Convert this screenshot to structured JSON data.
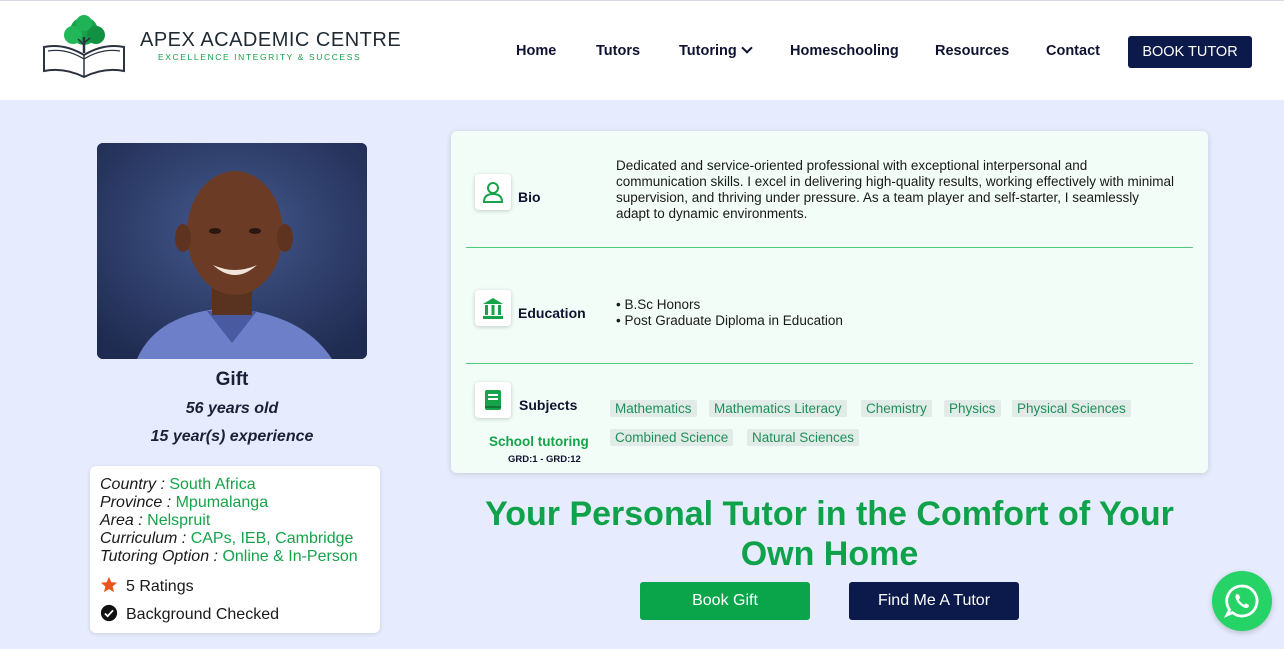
{
  "brand": {
    "title": "APEX ACADEMIC CENTRE",
    "tagline": "EXCELLENCE INTEGRITY & SUCCESS",
    "green": "#16a34a",
    "navy": "#0c1a4b"
  },
  "nav": {
    "items": [
      "Home",
      "Tutors",
      "Tutoring",
      "Homeschooling",
      "Resources",
      "Contact"
    ],
    "cta": "BOOK TUTOR"
  },
  "profile": {
    "name": "Gift",
    "age": "56 years old",
    "experience": "15 year(s) experience",
    "country_label": "Country : ",
    "country": "South Africa",
    "province_label": "Province : ",
    "province": "Mpumalanga",
    "area_label": "Area : ",
    "area": "Nelspruit",
    "curriculum_label": "Curriculum : ",
    "curriculum": "CAPs, IEB, Cambridge",
    "option_label": "Tutoring Option : ",
    "option": "Online & In-Person",
    "ratings": "5 Ratings",
    "background": "Background Checked"
  },
  "details": {
    "bio_label": "Bio",
    "bio": "Dedicated and service-oriented professional with exceptional interpersonal and communication skills. I excel in delivering high-quality results, working effectively with minimal supervision, and thriving under pressure. As a team player and self-starter, I seamlessly adapt to dynamic environments.",
    "education_label": "Education",
    "education": [
      "• B.Sc Honors",
      "• Post Graduate Diploma in Education"
    ],
    "subjects_label": "Subjects",
    "subjects": [
      "Mathematics",
      "Mathematics Literacy",
      "Chemistry",
      "Physics",
      "Physical Sciences",
      "Combined Science",
      "Natural Sciences"
    ],
    "school_label": "School tutoring",
    "grades": "GRD:1 - GRD:12"
  },
  "cta": {
    "headline": "Your Personal Tutor in the Comfort of Your Own Home",
    "book": "Book Gift",
    "find": "Find Me A Tutor"
  }
}
